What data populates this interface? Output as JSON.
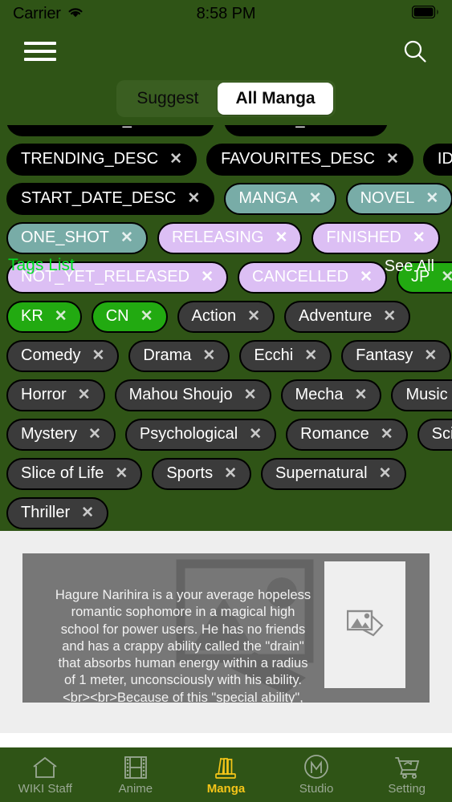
{
  "status_bar": {
    "carrier": "Carrier",
    "time": "8:58 PM",
    "wifi_icon": "wifi-icon",
    "battery_icon": "battery-icon"
  },
  "nav_bar": {
    "menu_icon": "hamburger-menu-icon",
    "search_icon": "search-icon"
  },
  "segmented_control": {
    "options": [
      {
        "label": "Suggest",
        "active": false
      },
      {
        "label": "All Manga",
        "active": true
      }
    ]
  },
  "filter_panel": {
    "tags_list_label": "Tags List",
    "see_all_label": "See All",
    "tags_list_color": "#00e024",
    "chip_colors": {
      "sort": "#000000",
      "format": "#78aca7",
      "status": "#dcbff4",
      "country": "#22aa11",
      "genre": "#3b3b3b"
    },
    "remove_glyph": "✕",
    "rows": [
      [
        {
          "label": "POPULARITY_DESC",
          "kind": "sort"
        },
        {
          "label": "SCORE_DESC",
          "kind": "sort"
        }
      ],
      [
        {
          "label": "TRENDING_DESC",
          "kind": "sort"
        },
        {
          "label": "FAVOURITES_DESC",
          "kind": "sort"
        },
        {
          "label": "ID_DESC",
          "kind": "sort"
        }
      ],
      [
        {
          "label": "START_DATE_DESC",
          "kind": "sort"
        },
        {
          "label": "MANGA",
          "kind": "format"
        },
        {
          "label": "NOVEL",
          "kind": "format"
        }
      ],
      [
        {
          "label": "ONE_SHOT",
          "kind": "format"
        },
        {
          "label": "RELEASING",
          "kind": "status"
        },
        {
          "label": "FINISHED",
          "kind": "status"
        }
      ],
      [
        {
          "label": "NOT_YET_RELEASED",
          "kind": "status"
        },
        {
          "label": "CANCELLED",
          "kind": "status"
        },
        {
          "label": "JP",
          "kind": "country"
        }
      ],
      [
        {
          "label": "KR",
          "kind": "country"
        },
        {
          "label": "CN",
          "kind": "country"
        },
        {
          "label": "Action",
          "kind": "genre"
        },
        {
          "label": "Adventure",
          "kind": "genre"
        }
      ],
      [
        {
          "label": "Comedy",
          "kind": "genre"
        },
        {
          "label": "Drama",
          "kind": "genre"
        },
        {
          "label": "Ecchi",
          "kind": "genre"
        },
        {
          "label": "Fantasy",
          "kind": "genre"
        }
      ],
      [
        {
          "label": "Horror",
          "kind": "genre"
        },
        {
          "label": "Mahou Shoujo",
          "kind": "genre"
        },
        {
          "label": "Mecha",
          "kind": "genre"
        },
        {
          "label": "Music",
          "kind": "genre"
        }
      ],
      [
        {
          "label": "Mystery",
          "kind": "genre"
        },
        {
          "label": "Psychological",
          "kind": "genre"
        },
        {
          "label": "Romance",
          "kind": "genre"
        },
        {
          "label": "Sci-Fi",
          "kind": "genre"
        }
      ],
      [
        {
          "label": "Slice of Life",
          "kind": "genre"
        },
        {
          "label": "Sports",
          "kind": "genre"
        },
        {
          "label": "Supernatural",
          "kind": "genre"
        }
      ],
      [
        {
          "label": "Thriller",
          "kind": "genre"
        }
      ]
    ]
  },
  "media_card": {
    "description": "Hagure Narihira is a your average hopeless romantic sophomore in a magical high school for power users. He has no friends and has a crappy ability called the \"drain\" that absorbs human energy within a radius of 1 meter, unconsciously with his ability. <br><br>Because of this \"special ability\", he was unable to make friends and his only...",
    "cover_icon": "image-placeholder-icon",
    "background_icon": "image-placeholder-icon"
  },
  "tab_bar": {
    "active_color": "#f5c518",
    "inactive_color": "#9aa894",
    "items": [
      {
        "label": "WIKI Staff",
        "icon": "home-icon",
        "active": false
      },
      {
        "label": "Anime",
        "icon": "film-strip-icon",
        "active": false
      },
      {
        "label": "Manga",
        "icon": "books-icon",
        "active": true
      },
      {
        "label": "Studio",
        "icon": "studio-monogram-icon",
        "active": false
      },
      {
        "label": "Setting",
        "icon": "shopping-cart-icon",
        "active": false
      }
    ]
  }
}
